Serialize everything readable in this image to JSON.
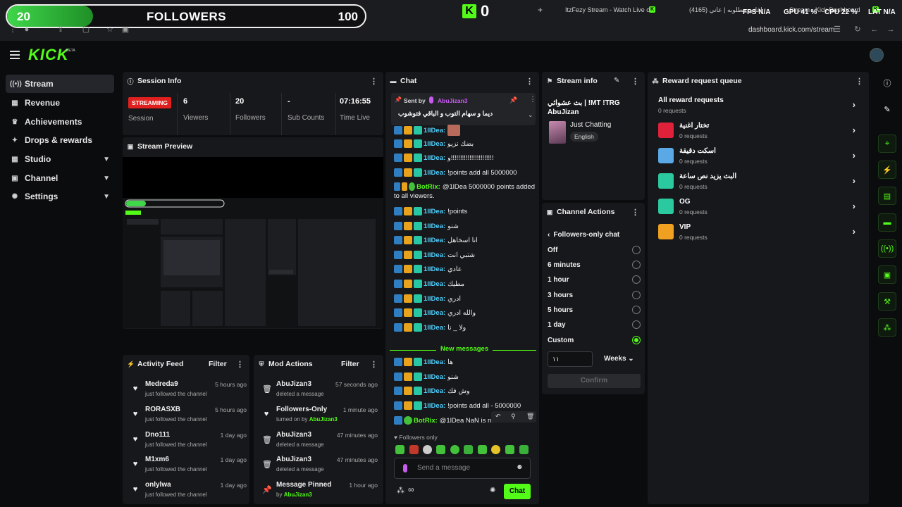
{
  "overlay": {
    "followers_current": "20",
    "followers_label": "FOLLOWERS",
    "followers_goal": "100",
    "followers_progress": 0.2,
    "k_count": "0"
  },
  "browser": {
    "tabs": [
      "ItzFezy Stream - Watch Live on",
      "اغاني مطلوبه | عاني (4165)",
      "Stream - Kick Dashboard"
    ],
    "stats": {
      "fps_label": "FPS",
      "fps_val": "N/A",
      "gpu_label": "GPU",
      "gpu_val": "41 %",
      "cpu_label": "CPU",
      "cpu_val": "22 %",
      "lat_label": "LAT",
      "lat_val": "N/A"
    },
    "url": "dashboard.kick.com/stream"
  },
  "header": {
    "brand": "KICK",
    "beta": "BETA"
  },
  "sidebar": {
    "items": [
      {
        "label": "Stream",
        "icon": "broadcast-icon"
      },
      {
        "label": "Revenue",
        "icon": "wallet-icon"
      },
      {
        "label": "Achievements",
        "icon": "trophy-icon"
      },
      {
        "label": "Drops & rewards",
        "icon": "gift-icon"
      },
      {
        "label": "Studio",
        "icon": "grid-icon"
      },
      {
        "label": "Channel",
        "icon": "user-icon"
      },
      {
        "label": "Settings",
        "icon": "gear-icon"
      }
    ]
  },
  "session": {
    "title": "Session Info",
    "status": "STREAMING",
    "status_label": "Session",
    "viewers": "6",
    "viewers_label": "Viewers",
    "followers": "20",
    "followers_label": "Followers",
    "subs": "-",
    "subs_label": "Sub Counts",
    "time": "07:16:55",
    "time_label": "Time Live"
  },
  "preview": {
    "title": "Stream Preview"
  },
  "activity": {
    "title": "Activity Feed",
    "filter": "Filter",
    "items": [
      {
        "name": "Medreda9",
        "sub": "just followed the channel",
        "time": "5 hours ago"
      },
      {
        "name": "RORASXB",
        "sub": "just followed the channel",
        "time": "5 hours ago"
      },
      {
        "name": "Dno111",
        "sub": "just followed the channel",
        "time": "1 day ago"
      },
      {
        "name": "M1xm6",
        "sub": "just followed the channel",
        "time": "1 day ago"
      },
      {
        "name": "onlylwa",
        "sub": "just followed the channel",
        "time": "1 day ago"
      }
    ]
  },
  "mod": {
    "title": "Mod Actions",
    "filter": "Filter",
    "items": [
      {
        "name": "AbuJizan3",
        "sub": "deleted a message",
        "time": "57 seconds ago",
        "icon": "trash-icon"
      },
      {
        "name": "Followers-Only",
        "sub": "turned on by",
        "by": "AbuJizan3",
        "time": "1 minute ago",
        "icon": "heart-icon"
      },
      {
        "name": "AbuJizan3",
        "sub": "deleted a message",
        "time": "47 minutes ago",
        "icon": "trash-icon"
      },
      {
        "name": "AbuJizan3",
        "sub": "deleted a message",
        "time": "47 minutes ago",
        "icon": "trash-icon"
      },
      {
        "name": "Message Pinned",
        "sub": "by",
        "by": "AbuJizan3",
        "time": "1 hour ago",
        "icon": "pin-icon"
      }
    ]
  },
  "chat": {
    "title": "Chat",
    "pinned": {
      "sent_by": "Sent by",
      "user": "AbuJizan3",
      "text": "ديما و سهام التوب و الباقي فتوشوب"
    },
    "messages": [
      {
        "user": "1lIDea:",
        "text": "",
        "emoji": true
      },
      {
        "user": "1lIDea:",
        "text": "بضك نزيو"
      },
      {
        "user": "1lIDea:",
        "text": "و!!!!!!!!!!!!!!!!!!!!!!!"
      },
      {
        "user": "1lIDea:",
        "text": "!points add all 5000000"
      },
      {
        "user": "BotRix:",
        "text": "@1lDea 5000000 points added",
        "text2": "to all viewers.",
        "bot": true
      },
      {
        "user": "1lIDea:",
        "text": "!points"
      },
      {
        "user": "1lIDea:",
        "text": "شنو"
      },
      {
        "user": "1lIDea:",
        "text": "انا اسخاهل"
      },
      {
        "user": "1lIDea:",
        "text": "شتبي انت"
      },
      {
        "user": "1lIDea:",
        "text": "عادي"
      },
      {
        "user": "1lIDea:",
        "text": "مطيك"
      },
      {
        "user": "1lIDea:",
        "text": "ادري"
      },
      {
        "user": "1lIDea:",
        "text": "والله ادري"
      },
      {
        "user": "1lIDea:",
        "text": "ولا _ نا"
      }
    ],
    "new_messages": "New messages",
    "new": [
      {
        "user": "1lIDea:",
        "text": "ها"
      },
      {
        "user": "1lIDea:",
        "text": "شنو"
      },
      {
        "user": "1lIDea:",
        "text": "وش فك"
      },
      {
        "user": "1lIDea:",
        "text": "!points add all - 5000000"
      },
      {
        "user": "BotRix:",
        "text": "@1lDea NaN is not a number.",
        "bot": true
      }
    ],
    "followers_only": "Followers only",
    "input_placeholder": "Send a message",
    "send": "Chat"
  },
  "stream_info": {
    "title": "Stream info",
    "stream_title": "بث عشوائي | !MT !TRG",
    "streamer": "AbuJizan",
    "category": "Just Chatting",
    "language": "English"
  },
  "channel_actions": {
    "title": "Channel Actions",
    "sub_title": "Followers-only chat",
    "options": [
      "Off",
      "6 minutes",
      "1 hour",
      "3 hours",
      "5 hours",
      "1 day",
      "Custom"
    ],
    "selected": "Custom",
    "custom_value": "١١",
    "unit": "Weeks",
    "confirm": "Confirm"
  },
  "rewards": {
    "title": "Reward request queue",
    "all_label": "All reward requests",
    "all_count": "0 requests",
    "items": [
      {
        "name": "تختار اغنية",
        "count": "0 requests",
        "color": "#e0213a"
      },
      {
        "name": "اسكت دقيقة",
        "count": "0 requests",
        "color": "#5aa9e6"
      },
      {
        "name": "البث يزيد نص ساعة",
        "count": "0 requests",
        "color": "#2bc9a0"
      },
      {
        "name": "OG",
        "count": "0 requests",
        "color": "#2bc9a0"
      },
      {
        "name": "VIP",
        "count": "0 requests",
        "color": "#f0a020"
      }
    ]
  },
  "colors": {
    "accent": "#53fc18",
    "danger": "#e0201e"
  }
}
